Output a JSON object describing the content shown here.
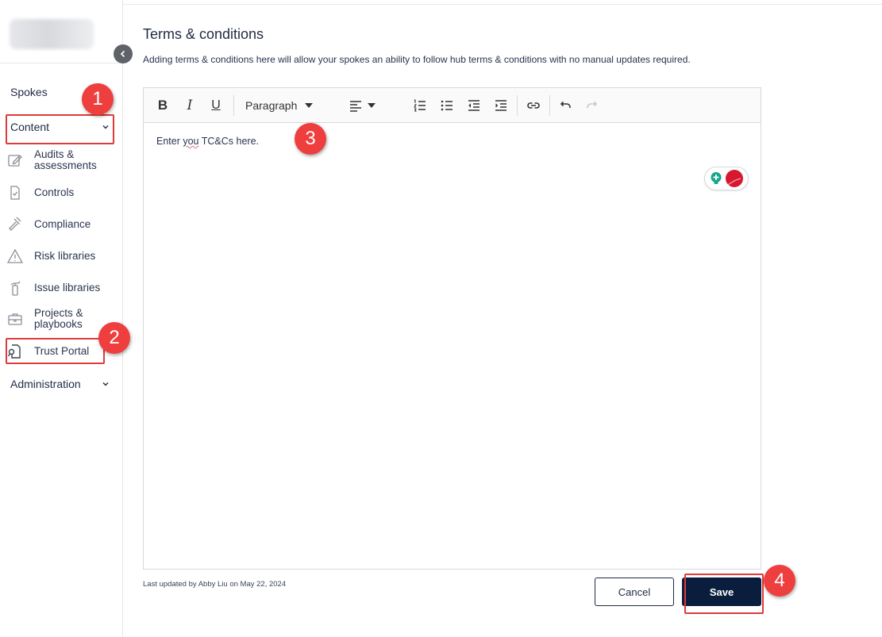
{
  "sidebar": {
    "spokes_label": "Spokes",
    "content_label": "Content",
    "administration_label": "Administration",
    "items": [
      {
        "label": "Audits & assessments",
        "icon": "edit-icon"
      },
      {
        "label": "Controls",
        "icon": "document-check-icon"
      },
      {
        "label": "Compliance",
        "icon": "gavel-icon"
      },
      {
        "label": "Risk libraries",
        "icon": "warning-triangle-icon"
      },
      {
        "label": "Issue libraries",
        "icon": "fire-extinguisher-icon"
      },
      {
        "label": "Projects & playbooks",
        "icon": "briefcase-icon"
      },
      {
        "label": "Trust Portal",
        "icon": "document-search-icon"
      }
    ]
  },
  "main": {
    "title": "Terms & conditions",
    "subtitle": "Adding terms & conditions here will allow your spokes an ability to follow hub terms & conditions with no manual updates required.",
    "editor": {
      "block_format": "Paragraph",
      "text_before": "Enter ",
      "text_misspelled": "you",
      "text_after": " TC&Cs here."
    },
    "last_updated": "Last updated by Abby Liu on May 22, 2024",
    "cancel_label": "Cancel",
    "save_label": "Save"
  },
  "annotations": [
    "1",
    "2",
    "3",
    "4"
  ],
  "colors": {
    "annotation_red": "#ef3e3e",
    "save_button": "#0b1d3d",
    "text_primary": "#1f2a44"
  }
}
